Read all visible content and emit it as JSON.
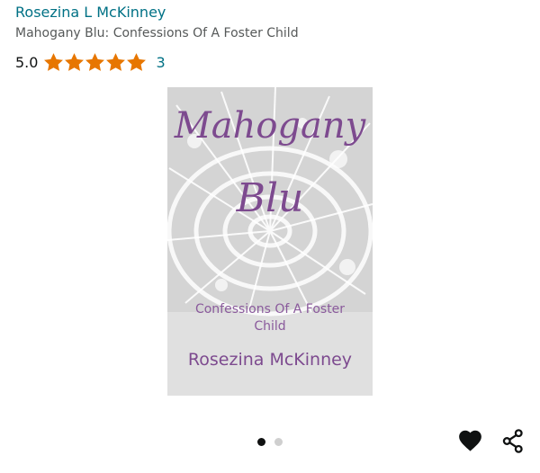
{
  "product": {
    "author": "Rosezina L McKinney",
    "title": "Mahogany Blu: Confessions Of A Foster Child",
    "rating_value": "5.0",
    "rating_stars": 5,
    "rating_count": "3"
  },
  "cover": {
    "title_line1": "Mahogany",
    "title_line2": "Blu",
    "subtitle": "Confessions Of A Foster Child",
    "author": "Rosezina McKinney"
  },
  "carousel": {
    "total": 2,
    "active_index": 0
  },
  "icons": {
    "star": "star-icon",
    "wishlist": "heart-icon",
    "share": "share-icon"
  },
  "colors": {
    "link": "#007185",
    "star": "#e77600",
    "cover_text": "#7d4a8f"
  }
}
